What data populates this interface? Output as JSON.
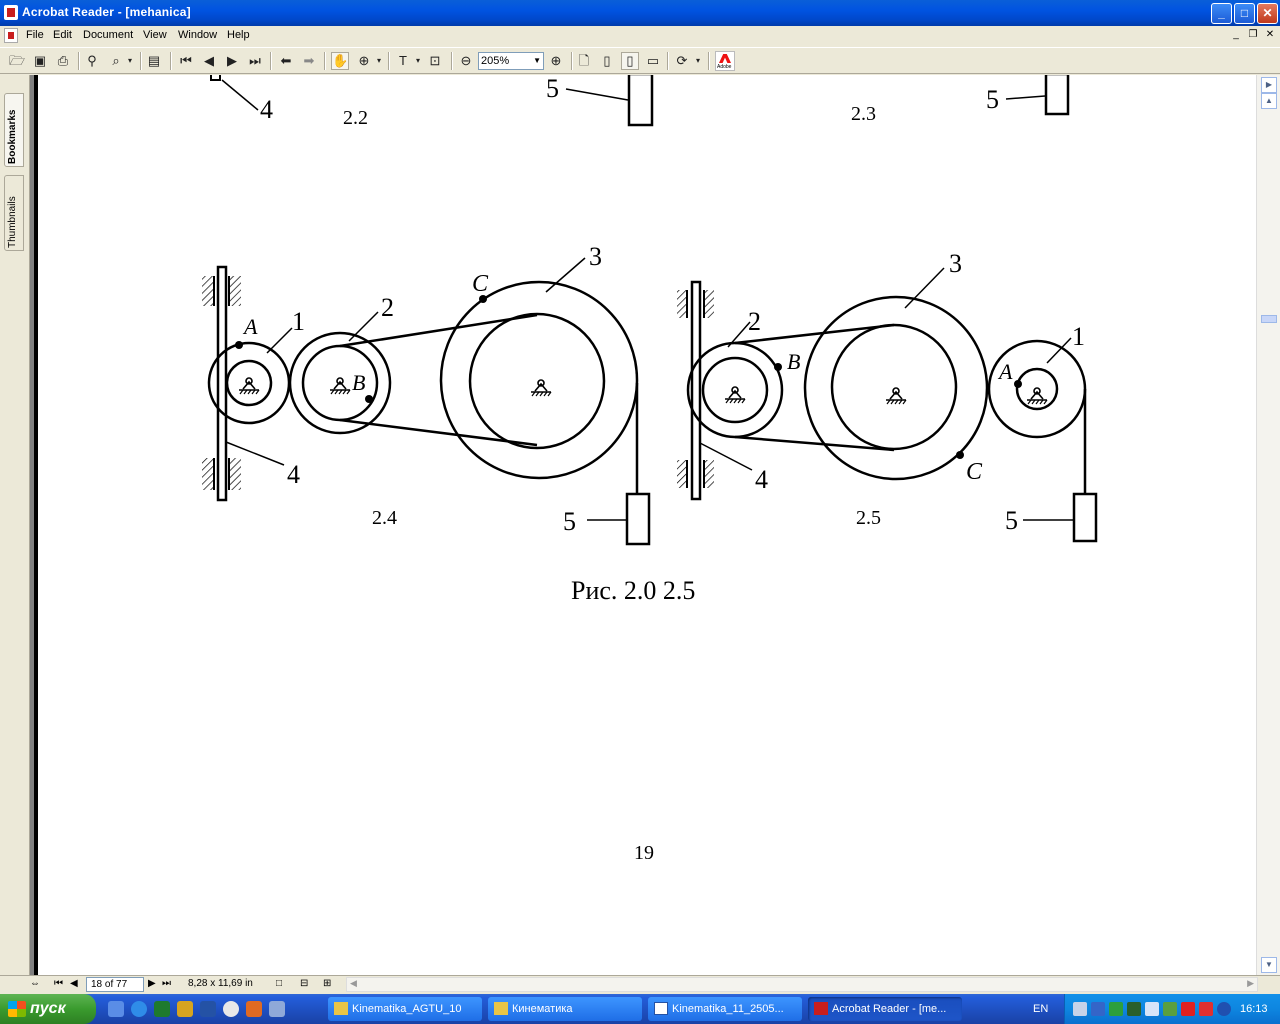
{
  "window": {
    "title": "Acrobat Reader - [mehanica]",
    "controls": {
      "minimize": "_",
      "maximize": "□",
      "close": "✕"
    }
  },
  "menu": {
    "items": [
      "File",
      "Edit",
      "Document",
      "View",
      "Window",
      "Help"
    ],
    "mdi_controls": {
      "minimize": "_",
      "restore": "❐",
      "close": "✕"
    }
  },
  "toolbar": {
    "zoom_value": "205%"
  },
  "navpane": {
    "tabs": [
      "Bookmarks",
      "Thumbnails"
    ]
  },
  "document": {
    "top_labels": {
      "label_4_top": "4",
      "fig_22": "2.2",
      "label_5_top_a": "5",
      "fig_23": "2.3",
      "label_5_top_b": "5"
    },
    "fig24": {
      "caption": "2.4",
      "label_1": "1",
      "label_2": "2",
      "label_3": "3",
      "label_4": "4",
      "label_5": "5",
      "point_A": "A",
      "point_B": "B",
      "point_C": "C"
    },
    "fig25": {
      "caption": "2.5",
      "label_1": "1",
      "label_2": "2",
      "label_3": "3",
      "label_4": "4",
      "label_5": "5",
      "point_A": "A",
      "point_B": "B",
      "point_C": "C"
    },
    "figure_caption": "Рис. 2.0  2.5",
    "page_number": "19"
  },
  "statusbar": {
    "page_indicator": "18 of 77",
    "page_size": "8,28 x 11,69 in"
  },
  "taskbar": {
    "start_label": "пуск",
    "tasks": [
      "Kinematika_AGTU_10",
      "Кинематика",
      "Kinematika_11_2505...",
      "Acrobat Reader - [me..."
    ],
    "language": "EN",
    "clock": "16:13"
  },
  "colors": {
    "titlebar": "#0053E1",
    "taskbar": "#245EDB",
    "start_button": "#3A9B2E",
    "chrome": "#ECE9D8",
    "adobe_red": "#E11111"
  }
}
